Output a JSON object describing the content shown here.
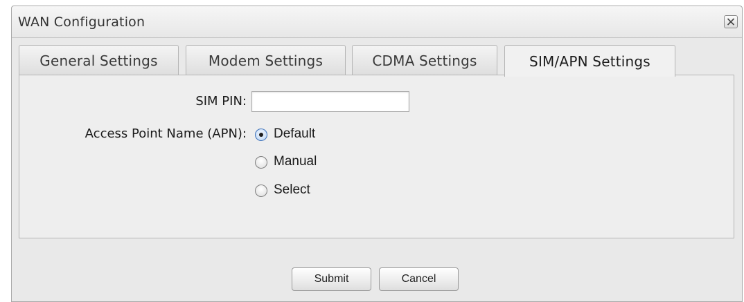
{
  "window": {
    "title": "WAN Configuration",
    "close_glyph": "✕"
  },
  "tabs": [
    {
      "label": "General Settings",
      "active": false
    },
    {
      "label": "Modem Settings",
      "active": false
    },
    {
      "label": "CDMA Settings",
      "active": false
    },
    {
      "label": "SIM/APN Settings",
      "active": true
    }
  ],
  "form": {
    "sim_pin_label": "SIM PIN:",
    "sim_pin_value": "",
    "sim_pin_placeholder": "",
    "apn_label": "Access Point Name (APN):",
    "apn_options": [
      {
        "label": "Default",
        "checked": true
      },
      {
        "label": "Manual",
        "checked": false
      },
      {
        "label": "Select",
        "checked": false
      }
    ]
  },
  "buttons": {
    "submit": "Submit",
    "cancel": "Cancel"
  },
  "colors": {
    "dialog_bg": "#e9e9e9",
    "panel_bg": "#eeeeee",
    "radio_accent": "#3a6fb8"
  }
}
